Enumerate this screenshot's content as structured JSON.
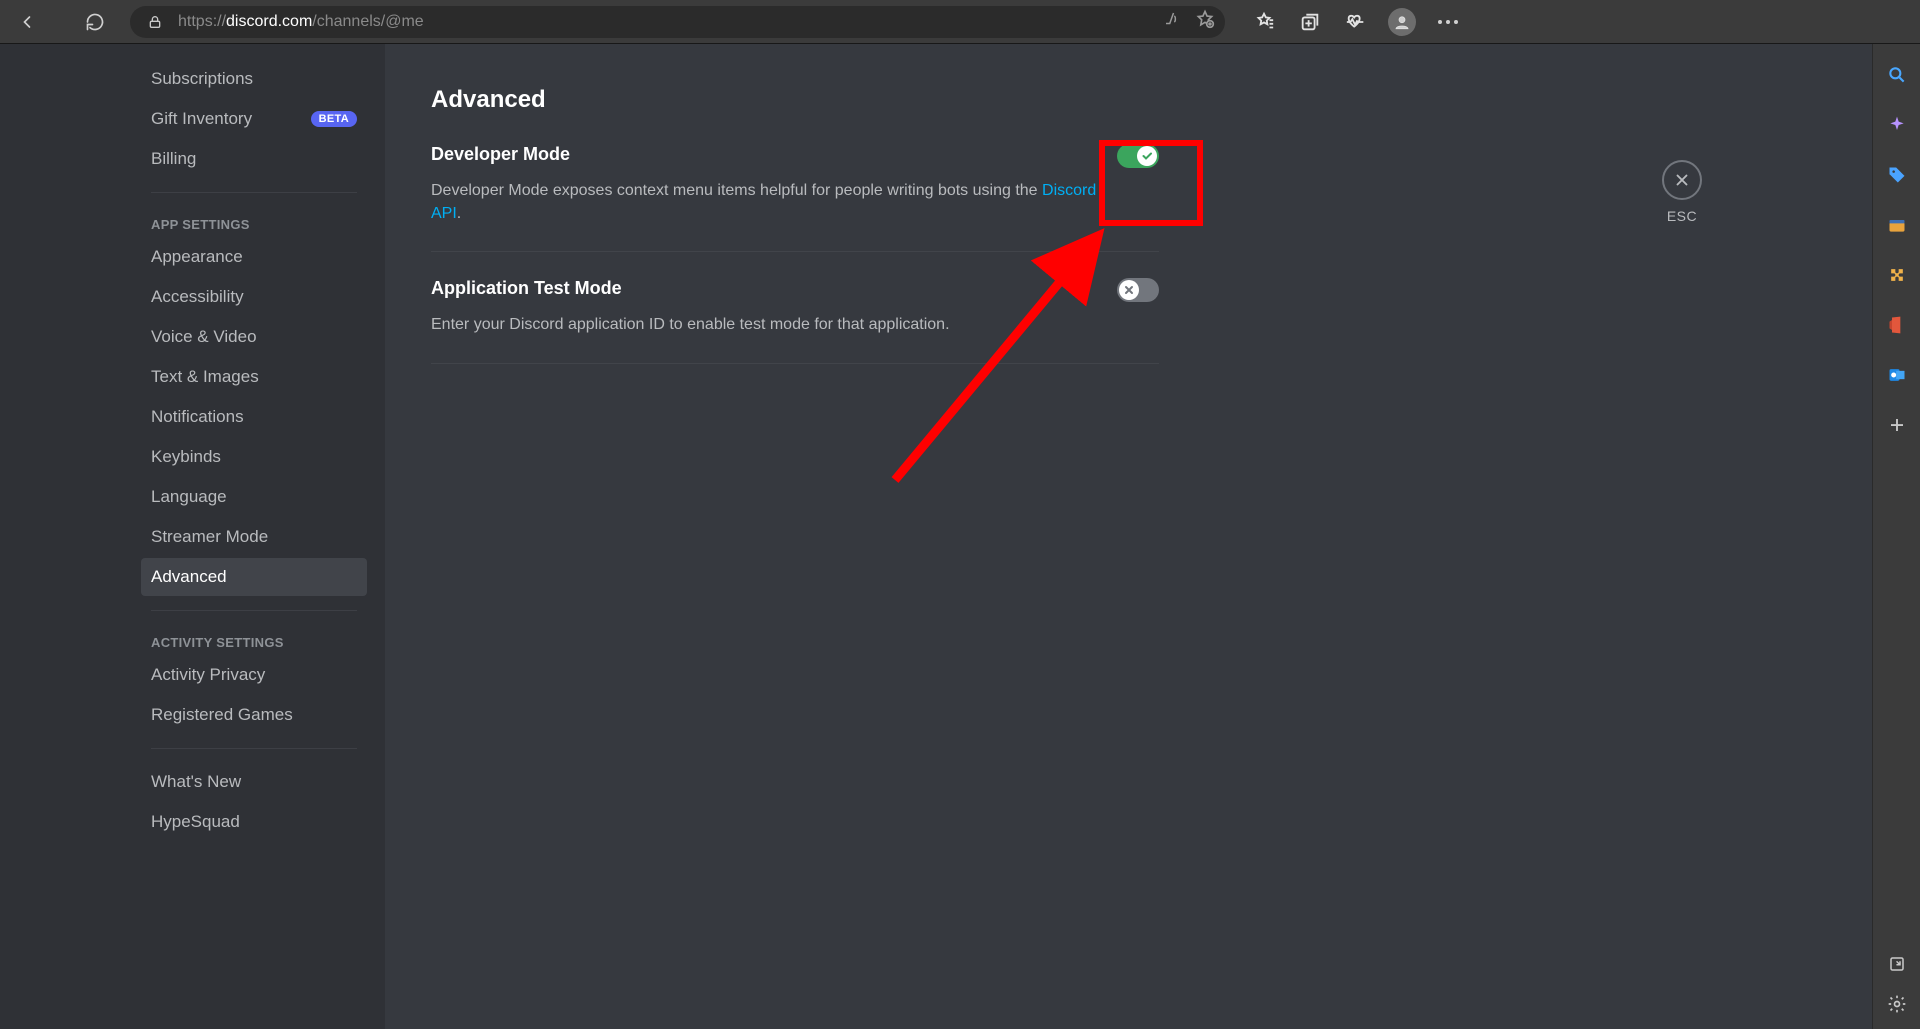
{
  "browser": {
    "url_prefix": "https://",
    "url_host": "discord.com",
    "url_path": "/channels/@me"
  },
  "sidebar": {
    "items_top": [
      {
        "label": "Subscriptions"
      },
      {
        "label": "Gift Inventory",
        "badge": "BETA"
      },
      {
        "label": "Billing"
      }
    ],
    "header_app": "APP SETTINGS",
    "items_app": [
      {
        "label": "Appearance"
      },
      {
        "label": "Accessibility"
      },
      {
        "label": "Voice & Video"
      },
      {
        "label": "Text & Images"
      },
      {
        "label": "Notifications"
      },
      {
        "label": "Keybinds"
      },
      {
        "label": "Language"
      },
      {
        "label": "Streamer Mode"
      },
      {
        "label": "Advanced",
        "selected": true
      }
    ],
    "header_activity": "ACTIVITY SETTINGS",
    "items_activity": [
      {
        "label": "Activity Privacy"
      },
      {
        "label": "Registered Games"
      }
    ],
    "items_bottom": [
      {
        "label": "What's New"
      },
      {
        "label": "HypeSquad"
      }
    ]
  },
  "page": {
    "title": "Advanced",
    "esc": "ESC",
    "settings": [
      {
        "title": "Developer Mode",
        "desc_pre": "Developer Mode exposes context menu items helpful for people writing bots using the ",
        "link": "Discord API",
        "desc_post": ".",
        "on": true
      },
      {
        "title": "Application Test Mode",
        "desc_pre": "Enter your Discord application ID to enable test mode for that application.",
        "link": "",
        "desc_post": "",
        "on": false
      }
    ]
  },
  "colors": {
    "accent_link": "#00aff4",
    "toggle_on": "#3ba55d",
    "toggle_off": "#72767d",
    "badge": "#5865f2",
    "annotation": "#ff0000"
  }
}
